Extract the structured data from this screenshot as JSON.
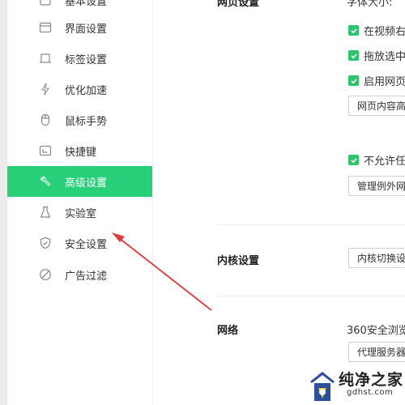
{
  "sidebar": {
    "items": [
      {
        "label": "基本设置",
        "icon": "settings-partial-icon"
      },
      {
        "label": "界面设置",
        "icon": "window-icon"
      },
      {
        "label": "标签设置",
        "icon": "tab-icon"
      },
      {
        "label": "优化加速",
        "icon": "lightning-icon"
      },
      {
        "label": "鼠标手势",
        "icon": "mouse-icon"
      },
      {
        "label": "快捷键",
        "icon": "shortcut-icon"
      },
      {
        "label": "高级设置",
        "icon": "wrench-icon",
        "active": true
      },
      {
        "label": "实验室",
        "icon": "flask-icon"
      },
      {
        "label": "安全设置",
        "icon": "shield-icon"
      },
      {
        "label": "广告过滤",
        "icon": "block-icon"
      }
    ]
  },
  "content": {
    "webpage_section_title": "网页设置",
    "font_size_text": "字体大小:",
    "checks": [
      {
        "label": "在视频右",
        "checked": true
      },
      {
        "label": "拖放选中",
        "checked": true
      },
      {
        "label": "启用网页",
        "checked": true
      }
    ],
    "content_button": "网页内容高",
    "popup_check": {
      "label": "不允许任",
      "checked": true
    },
    "manage_button": "管理例外网",
    "kernel_section_title": "内核设置",
    "kernel_button": "内核切换设",
    "network_section_title": "网络",
    "network_text": "360安全浏览",
    "proxy_button": "代理服务器"
  },
  "watermark": {
    "main": "纯净之家",
    "url": "gdhst.com"
  },
  "colors": {
    "accent": "#28d07a",
    "check": "#2cc56e",
    "arrow": "#e03a3a"
  }
}
